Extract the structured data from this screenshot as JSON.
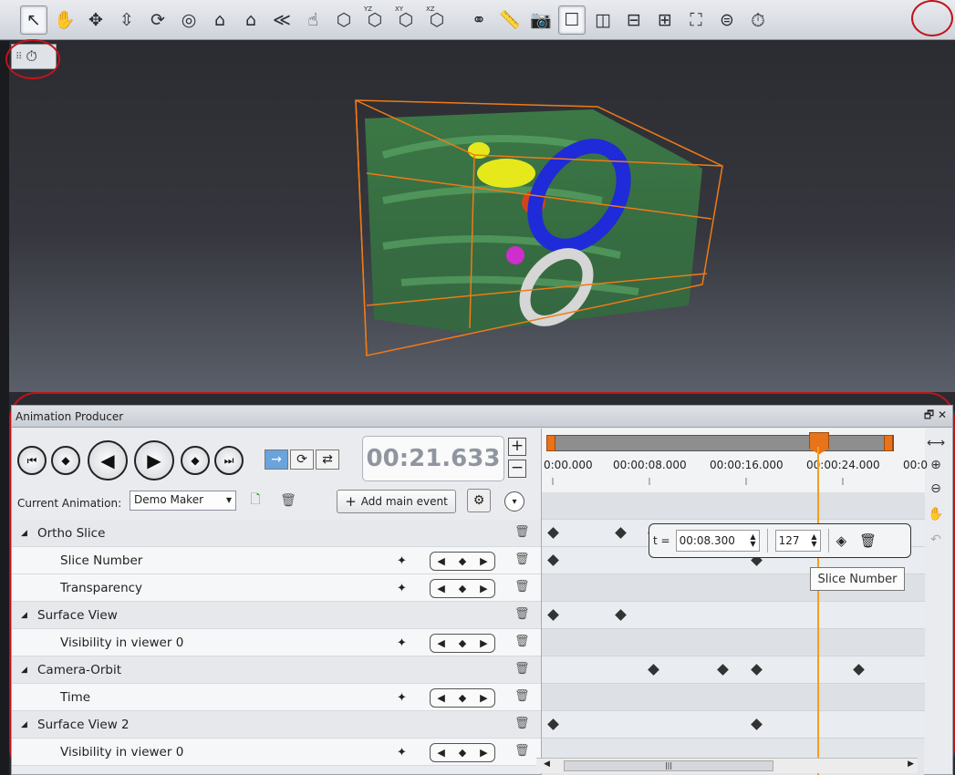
{
  "toolbar": {
    "icons": [
      "pointer-icon",
      "hand-pan-icon",
      "move-icon",
      "zoom-icon",
      "rotate-icon",
      "trackball-icon",
      "home-icon",
      "set-home-icon",
      "seek-icon",
      "interactive-pick-icon",
      "view-front-icon",
      "view-yz-icon",
      "view-xy-icon",
      "view-xz-icon",
      "stereo-glasses-icon",
      "measure-icon",
      "snapshot-icon",
      "layout-single-icon",
      "layout-split-vertical-icon",
      "layout-split-horizontal-icon",
      "layout-quad-icon",
      "fullscreen-icon",
      "link-viewers-icon",
      "animation-producer-icon"
    ],
    "axis_labels": [
      "YZ",
      "XY",
      "XZ"
    ]
  },
  "panel": {
    "title": "Animation Producer",
    "time_display": "00:21.633",
    "current_animation_label": "Current Animation:",
    "current_animation_value": "Demo Maker",
    "add_event_label": "Add main event",
    "tracks": [
      {
        "label": "Ortho Slice",
        "type": "group"
      },
      {
        "label": "Slice Number",
        "type": "child"
      },
      {
        "label": "Transparency",
        "type": "child"
      },
      {
        "label": "Surface View",
        "type": "group"
      },
      {
        "label": "Visibility in viewer 0",
        "type": "child"
      },
      {
        "label": "Camera-Orbit",
        "type": "group"
      },
      {
        "label": "Time",
        "type": "child"
      },
      {
        "label": "Surface View 2",
        "type": "group"
      },
      {
        "label": "Visibility in viewer 0",
        "type": "child"
      }
    ]
  },
  "timeline": {
    "ticks": [
      "0:00.000",
      "00:00:08.000",
      "00:00:16.000",
      "00:00:24.000",
      "00:0"
    ],
    "keyframes": [
      {
        "row": 1,
        "times": [
          0.0,
          5.6,
          8.3,
          14.0,
          16.8,
          26.0
        ]
      },
      {
        "row": 2,
        "times": [
          0.0,
          16.8
        ]
      },
      {
        "row": 4,
        "times": [
          0.0,
          5.6
        ]
      },
      {
        "row": 6,
        "times": [
          8.3,
          14.0,
          16.8,
          25.3
        ]
      },
      {
        "row": 8,
        "times": [
          0.0,
          16.8
        ]
      }
    ]
  },
  "popup": {
    "t_label": "t =",
    "t_value": "00:08.300",
    "value": "127"
  },
  "tooltip": "Slice Number",
  "colors": {
    "highlight_circle": "#c0141b",
    "cursor": "#f0a020",
    "scene_box": "#f07a16"
  }
}
